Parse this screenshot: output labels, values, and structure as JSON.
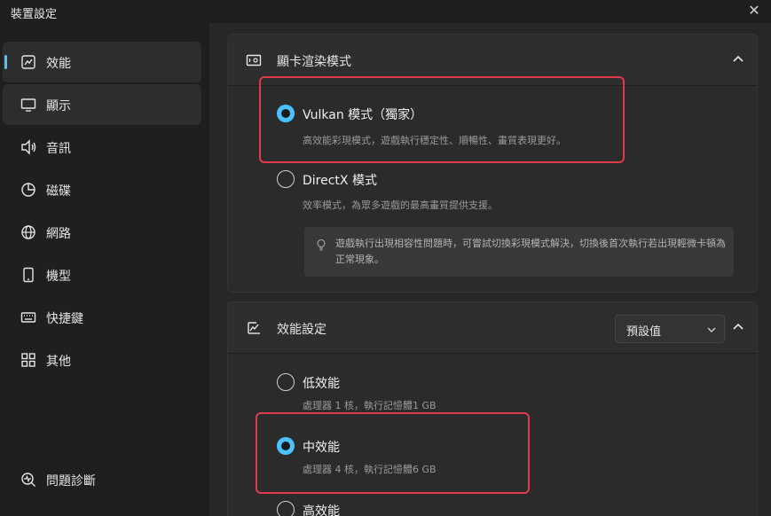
{
  "window": {
    "title": "裝置設定"
  },
  "sidebar": {
    "items": [
      {
        "label": "效能",
        "icon": "chart-line-icon"
      },
      {
        "label": "顯示",
        "icon": "monitor-icon"
      },
      {
        "label": "音訊",
        "icon": "speaker-icon"
      },
      {
        "label": "磁碟",
        "icon": "pie-chart-icon"
      },
      {
        "label": "網路",
        "icon": "globe-icon"
      },
      {
        "label": "機型",
        "icon": "phone-icon"
      },
      {
        "label": "快捷鍵",
        "icon": "keyboard-icon"
      },
      {
        "label": "其他",
        "icon": "grid-icon"
      }
    ],
    "diagnostics": {
      "label": "問題診斷",
      "icon": "diagnose-icon"
    }
  },
  "graphics": {
    "title": "顯卡渲染模式",
    "options": [
      {
        "label": "Vulkan 模式（獨家）",
        "desc": "高效能彩現模式，遊戲執行穩定性、順暢性、畫質表現更好。",
        "checked": true
      },
      {
        "label": "DirectX 模式",
        "desc": "效率模式，為眾多遊戲的最高畫質提供支援。",
        "checked": false
      }
    ],
    "hint": "遊戲執行出現相容性問題時，可嘗試切換彩現模式解決，切換後首次執行若出現輕微卡頓為正常現象。"
  },
  "performance": {
    "title": "效能設定",
    "preset": "預設值",
    "options": [
      {
        "label": "低效能",
        "desc": "處理器 1 核，執行記憶體1 GB",
        "checked": false
      },
      {
        "label": "中效能",
        "desc": "處理器 4 核，執行記憶體6 GB",
        "checked": true
      },
      {
        "label": "高效能",
        "desc": "",
        "checked": false
      }
    ]
  },
  "colors": {
    "accent": "#4cc2ff",
    "highlight": "#e03a4a"
  }
}
